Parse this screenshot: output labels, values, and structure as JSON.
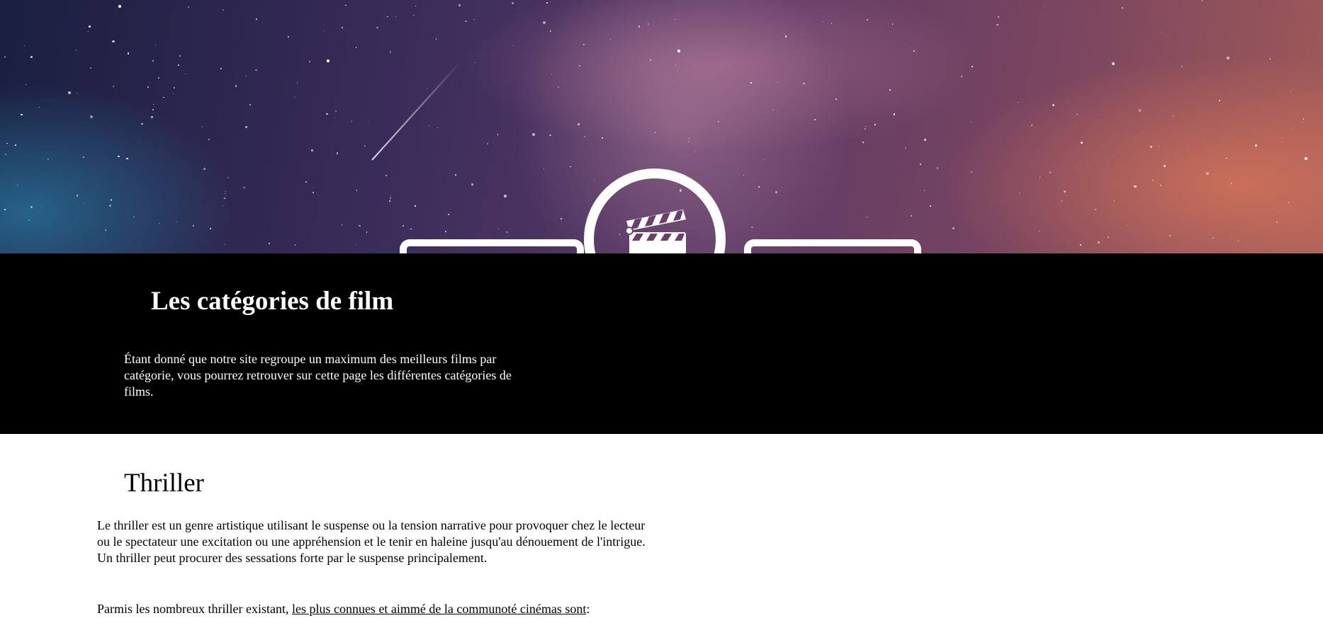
{
  "logo": {
    "icon": "film-clapperboard-icon"
  },
  "banner": {
    "title": "Les catégories de film",
    "description": "Étant donné que notre site regroupe un maximum des meilleurs films par catégorie, vous pourrez retrouver sur cette page les différentes catégories de films."
  },
  "thriller": {
    "title": "Thriller",
    "paragraph": "Le thriller est un genre artistique utilisant le suspense ou la tension narrative pour provoquer chez le lecteur ou le spectateur une excitation ou une appréhension et le tenir en haleine jusqu'au dénouement de l'intrigue. Un thriller peut procurer des sessations forte par le suspense principalement.",
    "list_intro": "Parmis les nombreux thriller existant, ",
    "list_link": "les plus connues et aimmé de la communoté cinémas sont",
    "list_suffix": ":"
  }
}
